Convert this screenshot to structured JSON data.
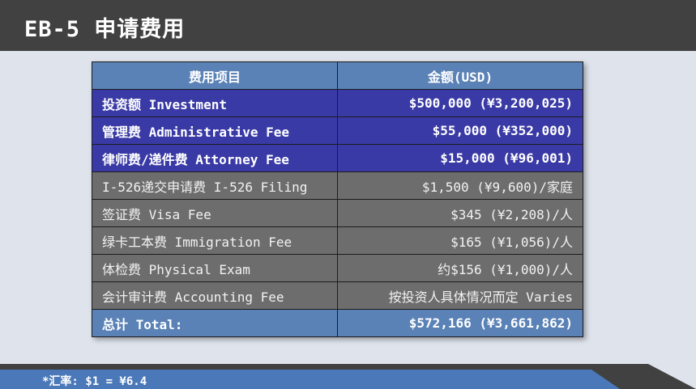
{
  "header": {
    "title": "EB-5 申请费用"
  },
  "table": {
    "headers": {
      "item": "费用项目",
      "amount": "金额(USD)"
    },
    "major_rows": [
      {
        "item": "投资额 Investment",
        "amount": "$500,000 (¥3,200,025)"
      },
      {
        "item": "管理费 Administrative Fee",
        "amount": "$55,000 (¥352,000)"
      },
      {
        "item": "律师费/递件费 Attorney Fee",
        "amount": "$15,000 (¥96,001)"
      }
    ],
    "minor_rows": [
      {
        "item": "I-526递交申请费 I-526 Filing",
        "amount": "$1,500 (¥9,600)/家庭"
      },
      {
        "item": "签证费 Visa Fee",
        "amount": "$345 (¥2,208)/人"
      },
      {
        "item": "绿卡工本费 Immigration Fee",
        "amount": "$165 (¥1,056)/人"
      },
      {
        "item": "体检费 Physical Exam",
        "amount": "约$156 (¥1,000)/人"
      },
      {
        "item": "会计审计费 Accounting Fee",
        "amount": "按投资人具体情况而定 Varies"
      }
    ],
    "total": {
      "item": "总计 Total:",
      "amount": "$572,166 (¥3,661,862)"
    }
  },
  "footer": {
    "note": "*汇率: $1 = ¥6.4"
  },
  "colors": {
    "header_bg": "#414141",
    "major_row": "#3a3aa6",
    "minor_row": "#6d6d6d",
    "header_total_row": "#5a82b6",
    "footer_blue": "#4a78b8",
    "footer_dark": "#414141"
  }
}
